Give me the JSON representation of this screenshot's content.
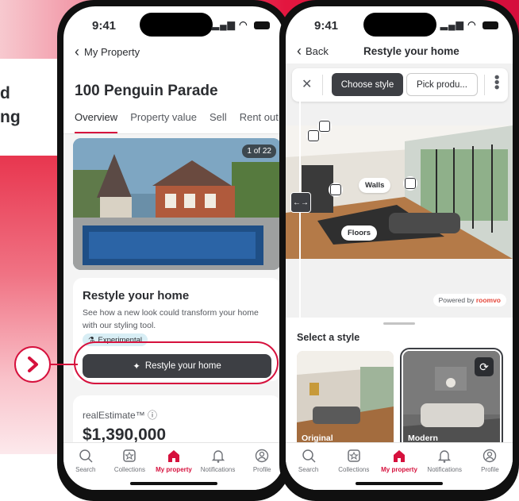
{
  "left_panel": {
    "line1": "d",
    "line2": "ng"
  },
  "status_bar": {
    "time": "9:41"
  },
  "screen1": {
    "back_label": "My Property",
    "property_title": "100 Penguin Parade",
    "tabs": [
      {
        "label": "Overview",
        "active": true
      },
      {
        "label": "Property value",
        "active": false
      },
      {
        "label": "Sell",
        "active": false
      },
      {
        "label": "Rent out",
        "active": false
      }
    ],
    "image_counter": "1 of 22",
    "restyle_card": {
      "title": "Restyle your home",
      "description": "See how a new look could transform your home with our styling tool.",
      "badge": "Experimental",
      "button_label": "Restyle your home"
    },
    "estimate": {
      "label": "realEstimate™ ⓘ",
      "value": "$1,390,000"
    }
  },
  "screen2": {
    "back_label": "Back",
    "title": "Restyle your home",
    "toolbar": {
      "choose_label": "Choose style",
      "pick_label": "Pick produ..."
    },
    "labels": {
      "walls": "Walls",
      "floors": "Floors"
    },
    "powered_prefix": "Powered by ",
    "powered_brand": "roomvo",
    "sheet_title": "Select a style",
    "styles": [
      {
        "label": "Original",
        "selected": false
      },
      {
        "label": "Modern",
        "selected": true
      }
    ]
  },
  "bottom_nav": [
    {
      "label": "Search",
      "icon": "search-icon",
      "active": false
    },
    {
      "label": "Collections",
      "icon": "collections-icon",
      "active": false
    },
    {
      "label": "My property",
      "icon": "house-icon",
      "active": true
    },
    {
      "label": "Notifications",
      "icon": "bell-icon",
      "active": false
    },
    {
      "label": "Profile",
      "icon": "profile-icon",
      "active": false
    }
  ],
  "colors": {
    "brand": "#d6113d",
    "dark_button": "#3d3f44"
  }
}
